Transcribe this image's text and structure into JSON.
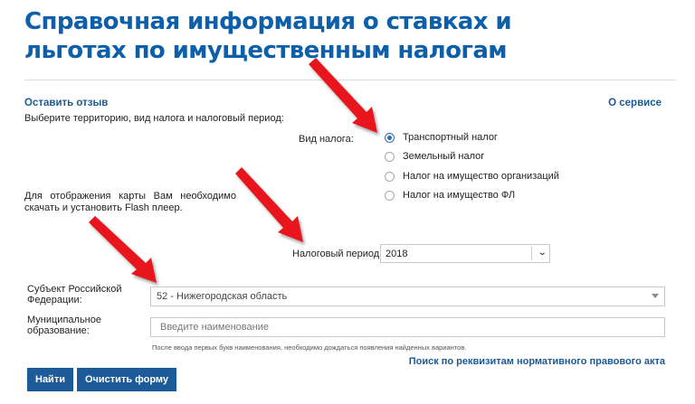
{
  "header": {
    "title": "Справочная информация о ставках и льготах по имущественным налогам"
  },
  "links": {
    "feedback": "Оставить отзыв",
    "about": "О сервисе",
    "requisites_search": "Поиск по реквизитам нормативного правового акта"
  },
  "form": {
    "intro": "Выберите территорию, вид налога и налоговый период:",
    "tax_type_label": "Вид налога:",
    "tax_types": [
      {
        "label": "Транспортный налог",
        "checked": true
      },
      {
        "label": "Земельный налог",
        "checked": false
      },
      {
        "label": "Налог на имущество организаций",
        "checked": false
      },
      {
        "label": "Налог на имущество ФЛ",
        "checked": false
      }
    ],
    "flash_note": "Для отображения карты Вам необходимо скачать и установить Flash плеер.",
    "tax_period_label": "Налоговый период:",
    "tax_period_value": "2018",
    "region_label": "Субъект Российской Федерации:",
    "region_value": "52 - Нижегородская область",
    "municipality_label": "Муниципальное образование:",
    "municipality_placeholder": "Введите наименование",
    "municipality_value": "",
    "hint": "После ввода первых букв наименования, необходимо дождаться появления найденных вариантов."
  },
  "buttons": {
    "find": "Найти",
    "clear": "Очистить форму"
  },
  "colors": {
    "title": "#0c5fa8",
    "link": "#1a5a96",
    "button": "#1c5a99",
    "annotation_arrow": "#e8121b"
  },
  "icons": {
    "period_dropdown": "chevron-down-icon",
    "region_dropdown": "caret-down-icon"
  }
}
